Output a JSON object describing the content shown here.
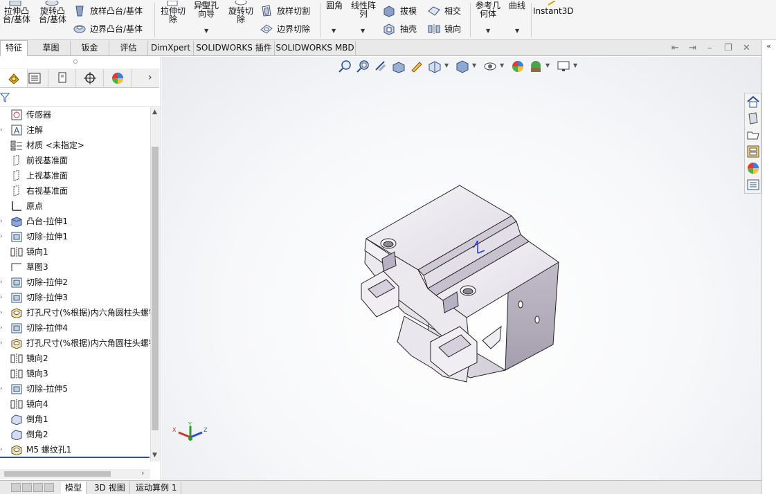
{
  "ribbon": {
    "extrude_boss": "拉伸凸\n台/基体",
    "revolve_boss": "旋转凸\n台/基体",
    "loft_boss": "放样凸台/基体",
    "boundary_boss": "边界凸台/基体",
    "extrude_cut": "拉伸切\n除",
    "hole_wizard": "异型孔\n向导",
    "revolve_cut": "旋转切\n除",
    "loft_cut": "放样切割",
    "boundary_cut": "边界切除",
    "fillet": "圆角",
    "linear_pattern": "线性阵\n列",
    "draft": "拔模",
    "shell": "抽壳",
    "intersect": "相交",
    "mirror": "镜向",
    "ref_geometry": "参考几\n何体",
    "curves": "曲线",
    "instant3d": "Instant3D"
  },
  "tabs": [
    "特征",
    "草图",
    "钣金",
    "评估",
    "DimXpert",
    "SOLIDWORKS 插件",
    "SOLIDWORKS MBD"
  ],
  "tree": [
    {
      "label": "传感器",
      "icon": "sensor-icon",
      "expand": false
    },
    {
      "label": "注解",
      "icon": "annotation-icon",
      "expand": true
    },
    {
      "label": "材质 <未指定>",
      "icon": "material-icon",
      "expand": false
    },
    {
      "label": "前视基准面",
      "icon": "plane-icon",
      "expand": false
    },
    {
      "label": "上视基准面",
      "icon": "plane-icon",
      "expand": false
    },
    {
      "label": "右视基准面",
      "icon": "plane-icon",
      "expand": false
    },
    {
      "label": "原点",
      "icon": "origin-icon",
      "expand": false
    },
    {
      "label": "凸台-拉伸1",
      "icon": "boss-extrude-icon",
      "expand": true
    },
    {
      "label": "切除-拉伸1",
      "icon": "cut-extrude-icon",
      "expand": true
    },
    {
      "label": "镜向1",
      "icon": "mirror-icon",
      "expand": false
    },
    {
      "label": "草图3",
      "icon": "sketch-icon",
      "expand": false
    },
    {
      "label": "切除-拉伸2",
      "icon": "cut-extrude-icon",
      "expand": true
    },
    {
      "label": "切除-拉伸3",
      "icon": "cut-extrude-icon",
      "expand": true
    },
    {
      "label": "打孔尺寸(%根据)内六角圆柱头螺钉",
      "icon": "hole-wizard-icon",
      "expand": true
    },
    {
      "label": "切除-拉伸4",
      "icon": "cut-extrude-icon",
      "expand": true
    },
    {
      "label": "打孔尺寸(%根据)内六角圆柱头螺钉",
      "icon": "hole-wizard-icon",
      "expand": true
    },
    {
      "label": "镜向2",
      "icon": "mirror-icon",
      "expand": false
    },
    {
      "label": "镜向3",
      "icon": "mirror-icon",
      "expand": false
    },
    {
      "label": "切除-拉伸5",
      "icon": "cut-extrude-icon",
      "expand": true
    },
    {
      "label": "镜向4",
      "icon": "mirror-icon",
      "expand": false
    },
    {
      "label": "倒角1",
      "icon": "chamfer-icon",
      "expand": false
    },
    {
      "label": "倒角2",
      "icon": "chamfer-icon",
      "expand": false
    },
    {
      "label": "M5 螺纹孔1",
      "icon": "hole-wizard-icon",
      "expand": true
    }
  ],
  "bottom_tabs": [
    "模型",
    "3D 视图",
    "运动算例 1"
  ],
  "triad": {
    "x": "X",
    "y": "Y",
    "z": "Z"
  },
  "colors": {
    "accent": "#2b4fb5",
    "model": "#e6e3ea"
  }
}
